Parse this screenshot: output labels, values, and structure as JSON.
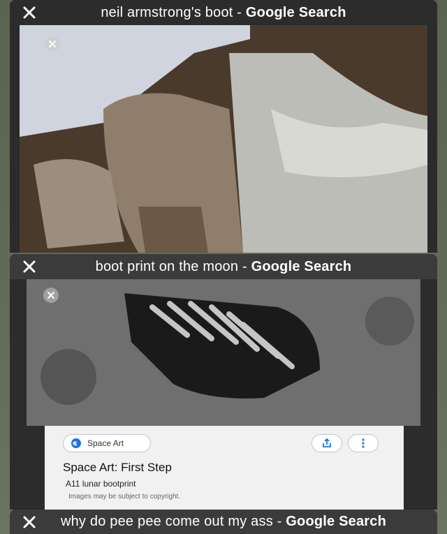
{
  "tabs": [
    {
      "title_prefix": "neil armstrong's boot - ",
      "title_suffix": "Google Search"
    },
    {
      "title_prefix": "boot print on the moon - ",
      "title_suffix": "Google Search",
      "card": {
        "source_label": "Space Art",
        "title": "Space Art: First Step",
        "subtitle": "A11 lunar bootprint",
        "note": "Images may be subject to copyright."
      }
    },
    {
      "title_prefix": "why do pee pee come out my ass - ",
      "title_suffix": "Google Search"
    }
  ],
  "colors": {
    "background": "#616b57",
    "tab_header": "#3a3b3a",
    "card_bg": "#f1f1f1",
    "accent_blue": "#1a73e8"
  },
  "icons": {
    "close": "close-icon",
    "share": "share-icon",
    "more": "more-vertical-icon",
    "globe": "globe-icon"
  }
}
